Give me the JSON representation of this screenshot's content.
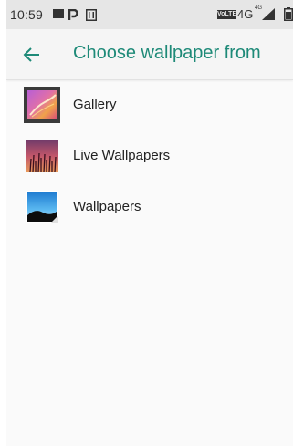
{
  "status_bar": {
    "time": "10:59",
    "volte": "VoLTE",
    "network": "4G",
    "network_sup": "4G",
    "icons": [
      "image-icon",
      "p-icon",
      "sim-card-icon",
      "signal-icon",
      "battery-icon"
    ]
  },
  "toolbar": {
    "title": "Choose wallpaper from",
    "back_icon": "arrow-left-icon",
    "accent_color": "#1e8a78"
  },
  "options": [
    {
      "label": "Gallery",
      "icon": "gallery-icon"
    },
    {
      "label": "Live Wallpapers",
      "icon": "live-wallpapers-icon"
    },
    {
      "label": "Wallpapers",
      "icon": "wallpapers-icon"
    }
  ]
}
